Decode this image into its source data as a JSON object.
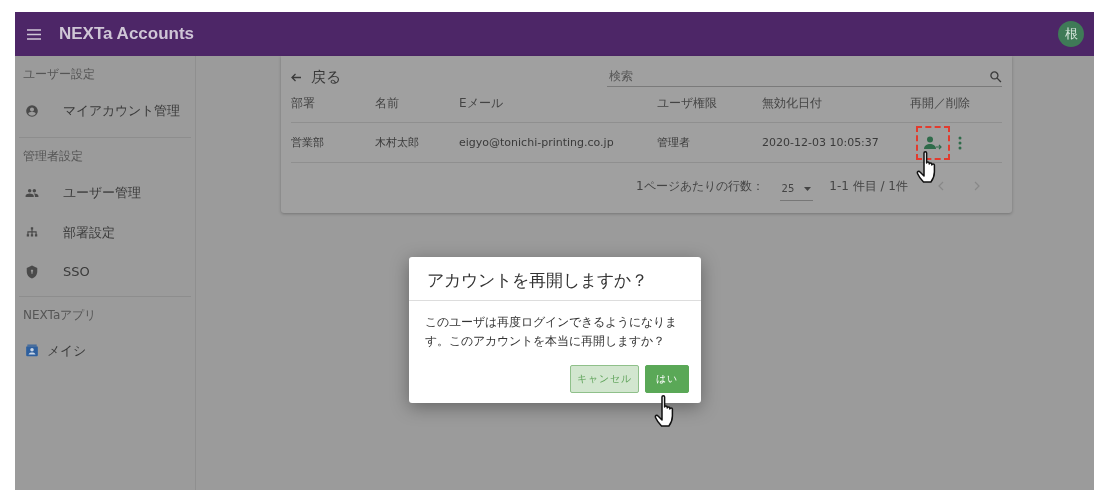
{
  "app_bar": {
    "title": "NEXTa Accounts",
    "avatar": "根"
  },
  "sidebar": [
    {
      "heading": "ユーザー設定",
      "items": [
        {
          "label": "マイアカウント管理",
          "kind": "setting"
        }
      ]
    },
    {
      "heading": "管理者設定",
      "items": [
        {
          "label": "ユーザー管理",
          "kind": "setting"
        },
        {
          "label": "部署設定",
          "kind": "setting"
        },
        {
          "label": "SSO",
          "kind": "setting"
        }
      ]
    },
    {
      "heading": "NEXTaアプリ",
      "items": [
        {
          "label": "メイシ",
          "kind": "app"
        }
      ]
    }
  ],
  "back": "戻る",
  "search": {
    "placeholder": "検索"
  },
  "table": {
    "columns": [
      "部署",
      "名前",
      "Eメール",
      "ユーザ権限",
      "無効化日付",
      "再開／削除"
    ],
    "rows": [
      {
        "cells": [
          "営業部",
          "木村太郎",
          "eigyo@tonichi-printing.co.jp",
          "管理者",
          "2020-12-03 10:05:37"
        ]
      }
    ]
  },
  "pagination": {
    "rows_label": "1ページあたりの行数：",
    "rows_per_page": "25",
    "range": "1-1 件目 / 1件"
  },
  "dialog": {
    "title": "アカウントを再開しますか？",
    "message": "このユーザは再度ログインできるようになります。このアカウントを本当に再開しますか？",
    "buttons": [
      {
        "label": "キャンセル",
        "kind": "secondary"
      },
      {
        "label": "はい",
        "kind": "primary"
      }
    ]
  }
}
